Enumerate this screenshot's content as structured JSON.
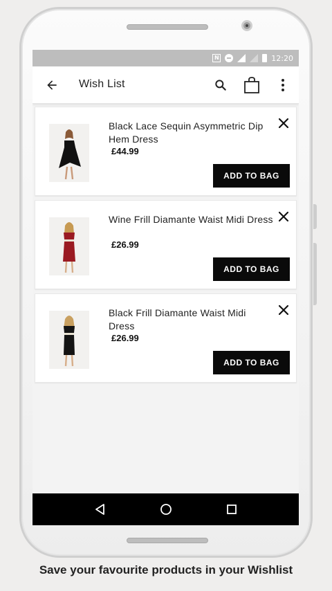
{
  "status_bar": {
    "time": "12:20"
  },
  "appbar": {
    "title": "Wish List",
    "back_icon": "arrow-left-icon",
    "search_icon": "search-icon",
    "bag_icon": "shopping-bag-icon",
    "menu_icon": "more-vert-icon"
  },
  "items": [
    {
      "name": "Black Lace Sequin Asymmetric Dip Hem Dress",
      "price": "£44.99",
      "button": "ADD TO BAG",
      "dress_color": "#111111"
    },
    {
      "name": "Wine Frill Diamante Waist Midi Dress",
      "price": "£26.99",
      "button": "ADD TO BAG",
      "dress_color": "#9a1a22"
    },
    {
      "name": "Black Frill Diamante Waist Midi Dress",
      "price": "£26.99",
      "button": "ADD TO BAG",
      "dress_color": "#141414"
    }
  ],
  "nav": {
    "back": "nav-back-icon",
    "home": "nav-home-icon",
    "recents": "nav-recents-icon"
  },
  "caption": "Save your favourite products in your Wishlist",
  "colors": {
    "primary_button": "#0a0a0a",
    "background": "#efeeed",
    "status_bar": "#bdbdbd"
  }
}
